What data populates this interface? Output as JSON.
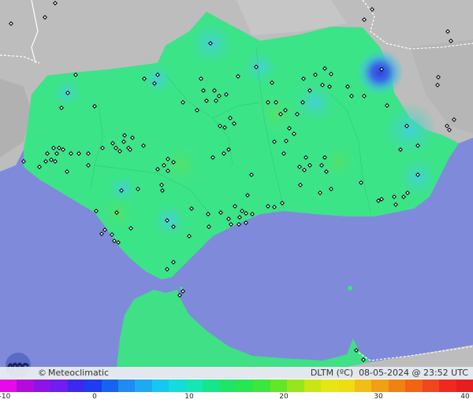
{
  "brand": {
    "symbol": "©",
    "name": "Meteoclimatic",
    "logo_icon": "meteoclimatic-logo-icon"
  },
  "variable": "DLTM (ºC)",
  "datetime": "08-05-2024 @ 23:52 UTC",
  "legend": {
    "ticks": [
      "-10",
      "0",
      "10",
      "20",
      "30",
      "40"
    ],
    "min": -10,
    "max": 40,
    "colors": [
      "#e60ae6",
      "#b40adc",
      "#8c14e6",
      "#6e1ef0",
      "#3c28f0",
      "#1e3cf0",
      "#1464f0",
      "#1e8cf0",
      "#1eaaf0",
      "#14c8f0",
      "#14dcdc",
      "#14e6b4",
      "#14e68c",
      "#1ee664",
      "#28e650",
      "#3ce63c",
      "#64e628",
      "#96e61e",
      "#c8e614",
      "#e6e614",
      "#f0dc14",
      "#f0be14",
      "#f0a014",
      "#f08214",
      "#f06414",
      "#f0461e",
      "#f0281e",
      "#e61e1e"
    ]
  },
  "colors": {
    "sea": "#7f8adb",
    "land_outside": "#bfbfbf",
    "andalusia": "#3ce488",
    "africa": "#3fe086",
    "cold_spot": "#3b4fe0"
  }
}
